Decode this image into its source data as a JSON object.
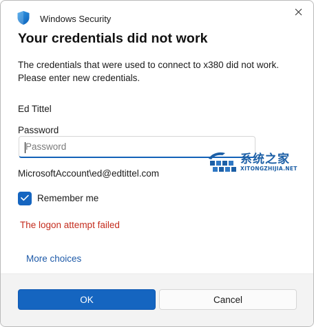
{
  "titlebar": {
    "title": "Windows Security",
    "icon": "shield-icon",
    "close_icon": "close-icon"
  },
  "dialog": {
    "heading": "Your credentials did not work",
    "description_line1": "The credentials that were used to connect to x380 did not work.",
    "description_line2": "Please enter new credentials.",
    "username": "Ed Tittel",
    "password_label": "Password",
    "password_placeholder": "Password",
    "password_value": "",
    "account_name": "MicrosoftAccount\\ed@edtittel.com",
    "remember_me_label": "Remember me",
    "remember_me_checked": true,
    "error_message": "The logon attempt failed",
    "more_choices_link": "More choices"
  },
  "footer": {
    "ok_label": "OK",
    "cancel_label": "Cancel"
  },
  "watermark": {
    "main_text": "系统之家",
    "sub_text": "XITONGZHIJIA.NET"
  },
  "colors": {
    "accent": "#1565c0",
    "error": "#c42b1c",
    "link": "#1e5aa8",
    "footer_bg": "#f3f3f3"
  }
}
